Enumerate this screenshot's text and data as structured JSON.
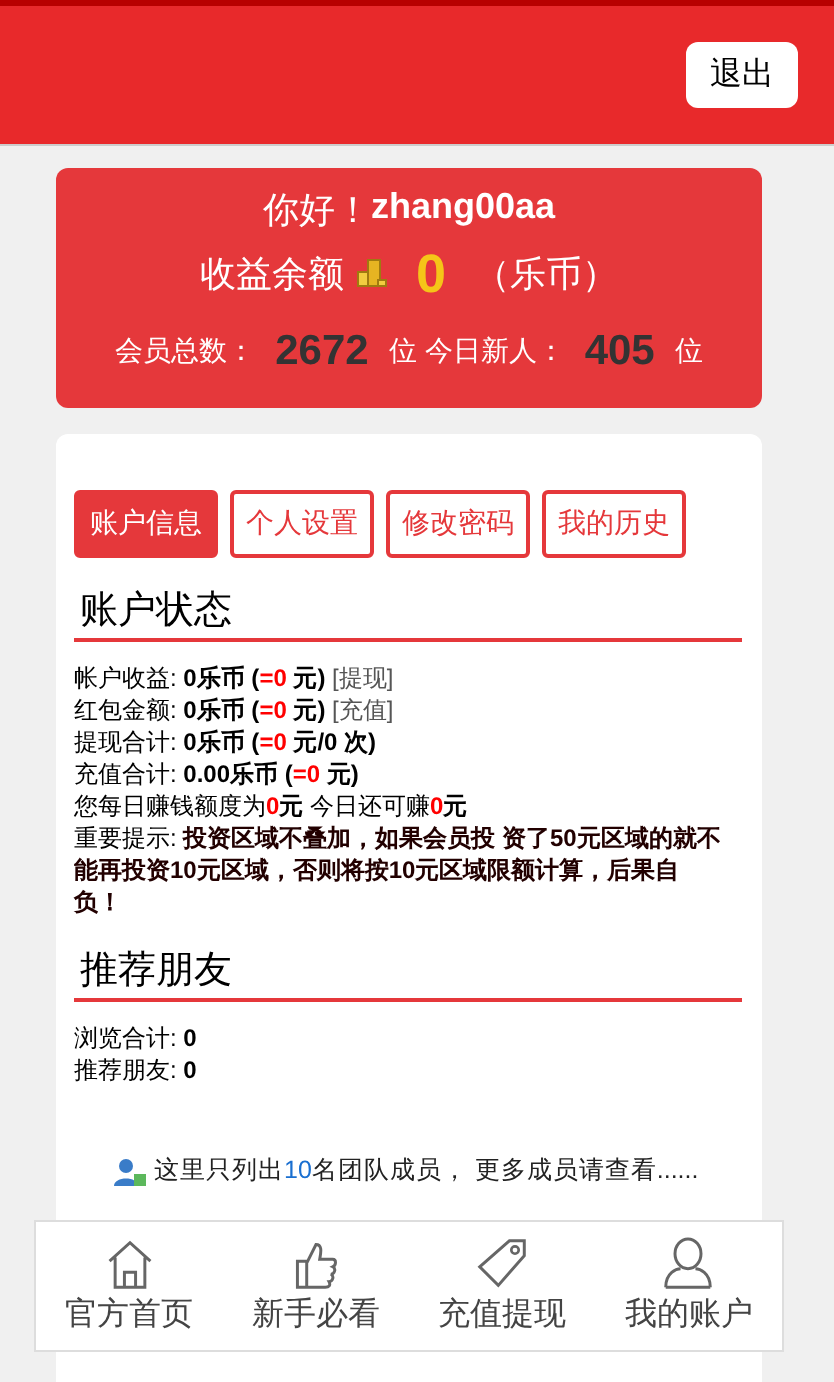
{
  "header": {
    "logout": "退出"
  },
  "summary": {
    "greeting": "你好！",
    "username": "zhang00aa",
    "balance_label": "收益余额",
    "balance": "0",
    "balance_unit": "（乐币）",
    "members_label": "会员总数：",
    "members": "2672",
    "members_unit": "位",
    "new_label": "今日新人：",
    "new_count": "405",
    "new_unit": "位"
  },
  "tabs": [
    {
      "label": "账户信息",
      "selected": true
    },
    {
      "label": "个人设置",
      "selected": false
    },
    {
      "label": "修改密码",
      "selected": false
    },
    {
      "label": "我的历史",
      "selected": false
    }
  ],
  "sections": [
    {
      "title": "账户状态",
      "lines": [
        [
          {
            "kind": "plain",
            "text": "帐户收益: "
          },
          {
            "kind": "bold",
            "text": "0乐币 ("
          },
          {
            "kind": "red",
            "text": "=0"
          },
          {
            "kind": "bold",
            "text": " 元)"
          },
          {
            "kind": "link",
            "text": " [提现]"
          }
        ],
        [
          {
            "kind": "plain",
            "text": "红包金额: "
          },
          {
            "kind": "bold",
            "text": "0乐币 ("
          },
          {
            "kind": "red",
            "text": "=0"
          },
          {
            "kind": "bold",
            "text": " 元)"
          },
          {
            "kind": "link",
            "text": " [充值]"
          }
        ],
        [
          {
            "kind": "plain",
            "text": "提现合计: "
          },
          {
            "kind": "bold",
            "text": "0乐币 ("
          },
          {
            "kind": "red",
            "text": "=0"
          },
          {
            "kind": "bold",
            "text": " 元/0 次)"
          }
        ],
        [
          {
            "kind": "plain",
            "text": "充值合计: "
          },
          {
            "kind": "bold",
            "text": "0.00乐币 ("
          },
          {
            "kind": "red",
            "text": "=0"
          },
          {
            "kind": "bold",
            "text": " 元)"
          }
        ],
        [
          {
            "kind": "plain",
            "text": "您每日赚钱额度为"
          },
          {
            "kind": "red",
            "text": "0"
          },
          {
            "kind": "bold",
            "text": "元"
          },
          {
            "kind": "plain",
            "text": " 今日还可赚"
          },
          {
            "kind": "red",
            "text": "0"
          },
          {
            "kind": "bold",
            "text": "元"
          }
        ],
        [
          {
            "kind": "plain",
            "text": "重要提示: "
          },
          {
            "kind": "warn",
            "text": "投资区域不叠加，如果会员投 资了50元区域的就不能再投资10元区域，否则将按10元区域限额计算，后果自负！"
          }
        ]
      ]
    },
    {
      "title": "推荐朋友",
      "lines": [
        [
          {
            "kind": "plain",
            "text": "浏览合计: "
          },
          {
            "kind": "bold",
            "text": "0"
          }
        ],
        [
          {
            "kind": "plain",
            "text": "推荐朋友: "
          },
          {
            "kind": "bold",
            "text": "0"
          }
        ]
      ]
    }
  ],
  "team_note": [
    {
      "kind": "plain",
      "text": "这里只列出"
    },
    {
      "kind": "number",
      "text": "10"
    },
    {
      "kind": "plain",
      "text": "名团队成员， 更多成员请查看......"
    }
  ],
  "nav": [
    {
      "label": "官方首页"
    },
    {
      "label": "新手必看"
    },
    {
      "label": "充值提现"
    },
    {
      "label": "我的账户"
    }
  ]
}
